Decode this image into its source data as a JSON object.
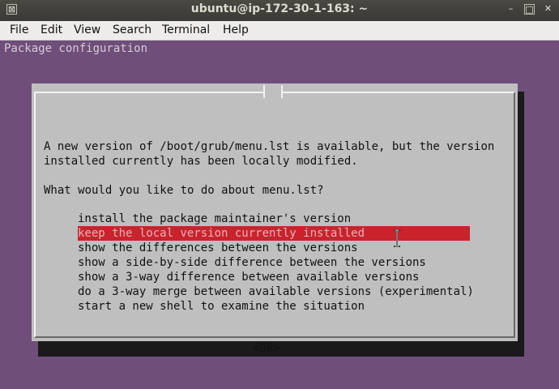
{
  "window": {
    "title": "ubuntu@ip-172-30-1-163: ~",
    "controls": {
      "left_icon": "⊠",
      "minimize": "–",
      "maximize": "□",
      "close": "✕"
    }
  },
  "menubar": {
    "items": [
      "File",
      "Edit",
      "View",
      "Search",
      "Terminal",
      "Help"
    ]
  },
  "terminal": {
    "header": "Package configuration"
  },
  "dialog": {
    "message_line1": "A new version of /boot/grub/menu.lst is available, but the version",
    "message_line2": "installed currently has been locally modified.",
    "question": "What would you like to do about menu.lst?",
    "options": [
      "install the package maintainer's version",
      "keep the local version currently installed",
      "show the differences between the versions",
      "show a side-by-side difference between the versions",
      "show a 3-way difference between available versions",
      "do a 3-way merge between available versions (experimental)",
      "start a new shell to examine the situation"
    ],
    "selected_index": 1,
    "ok_label": "<Ok>"
  },
  "colors": {
    "terminal_bg": "#6f4e79",
    "dialog_bg": "#bfbfbf",
    "selection_bg": "#c9232d"
  }
}
